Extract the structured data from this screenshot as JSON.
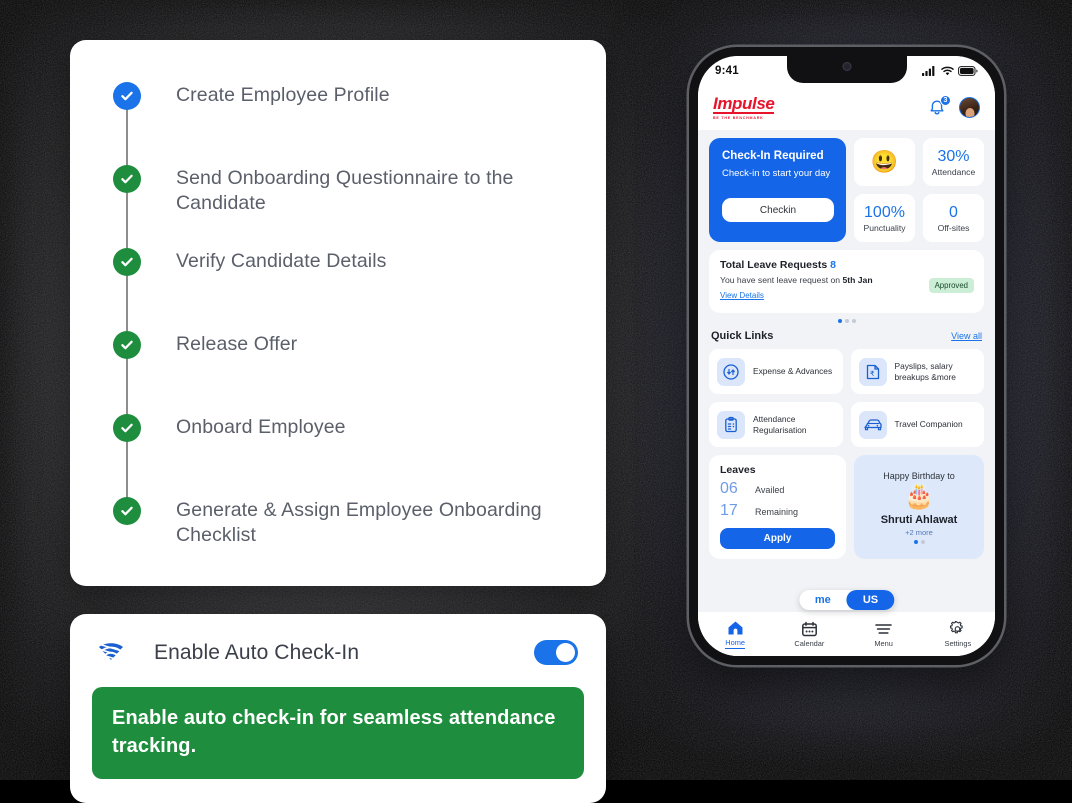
{
  "onboarding_checklist": {
    "steps": [
      {
        "label": "Create Employee Profile",
        "state": "current",
        "color": "#1a73e8"
      },
      {
        "label": "Send Onboarding Questionnaire to the Candidate",
        "state": "done",
        "color": "#1e8e3e"
      },
      {
        "label": "Verify Candidate Details",
        "state": "done",
        "color": "#1e8e3e"
      },
      {
        "label": "Release Offer",
        "state": "done",
        "color": "#1e8e3e"
      },
      {
        "label": "Onboard Employee",
        "state": "done",
        "color": "#1e8e3e"
      },
      {
        "label": "Generate & Assign Employee Onboarding Checklist",
        "state": "done",
        "color": "#1e8e3e"
      }
    ]
  },
  "auto_checkin": {
    "icon": "wifi-icon",
    "title": "Enable Auto Check-In",
    "toggle_state": "on",
    "banner_text": "Enable auto check-in for seamless attendance tracking.",
    "banner_color": "#1e8e3e"
  },
  "phone": {
    "status_bar": {
      "time": "9:41",
      "signal": "signal-icon",
      "wifi": "wifi-icon",
      "battery": "battery-icon"
    },
    "header": {
      "logo": "Impulse",
      "logo_tagline": "BE THE BENCHMARK",
      "notification_count": "3",
      "avatar": "user-avatar"
    },
    "checkin": {
      "title": "Check-In Required",
      "subtitle": "Check-in to start your day",
      "button": "Checkin"
    },
    "stats": [
      {
        "value": "",
        "label": "",
        "emoji": "😃"
      },
      {
        "value": "30%",
        "label": "Attendance"
      },
      {
        "value": "100%",
        "label": "Punctuality"
      },
      {
        "value": "0",
        "label": "Off-sites"
      }
    ],
    "leave_requests": {
      "title_prefix": "Total Leave Requests ",
      "count": "8",
      "subtitle_prefix": "You have sent leave request on ",
      "subtitle_date": "5th Jan",
      "link": "View Details",
      "status": "Approved"
    },
    "quick_links": {
      "title": "Quick Links",
      "view_all": "View all",
      "items": [
        {
          "label": "Expense & Advances",
          "icon": "expense-icon"
        },
        {
          "label": "Payslips, salary breakups &more",
          "icon": "payslip-icon"
        },
        {
          "label": "Attendance Regularisation",
          "icon": "clipboard-icon"
        },
        {
          "label": "Travel Companion",
          "icon": "car-icon"
        }
      ]
    },
    "leaves": {
      "title": "Leaves",
      "availed_value": "06",
      "availed_label": "Availed",
      "remaining_value": "17",
      "remaining_label": "Remaining",
      "apply_button": "Apply"
    },
    "birthday": {
      "heading": "Happy Birthday to",
      "emoji": "🎂",
      "name": "Shruti Ahlawat",
      "more": "+2 more"
    },
    "segment": {
      "left": "me",
      "right": "US",
      "active": "US"
    },
    "bottom_nav": [
      {
        "label": "Home",
        "icon": "home-icon",
        "active": true
      },
      {
        "label": "Calendar",
        "icon": "calendar-icon",
        "active": false
      },
      {
        "label": "Menu",
        "icon": "menu-icon",
        "active": false
      },
      {
        "label": "Settings",
        "icon": "gear-icon",
        "active": false
      }
    ]
  },
  "theme": {
    "blue": "#1a73e8",
    "green": "#1e8e3e",
    "red": "#e8142c",
    "screen_bg": "#f1f3f7"
  }
}
